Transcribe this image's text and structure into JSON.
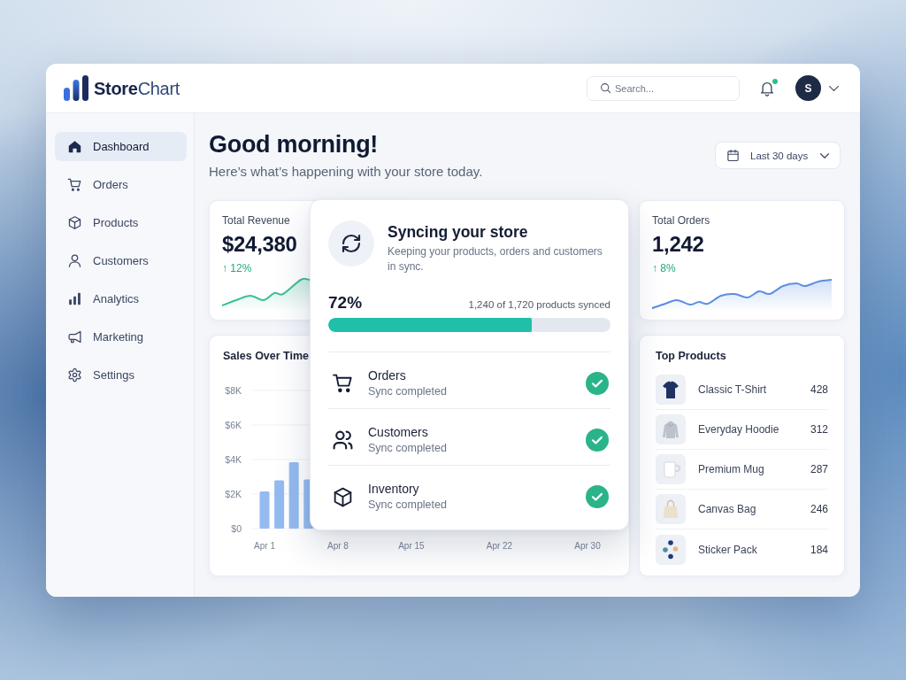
{
  "header": {
    "brand": "**Store**Chart",
    "search": {
      "placeholder": "Search..."
    },
    "notifications": {
      "unread": true
    },
    "user": {
      "initial": "S"
    }
  },
  "sidebar": {
    "items": [
      {
        "label": "Dashboard",
        "selected": true
      },
      {
        "label": "Orders",
        "selected": false
      },
      {
        "label": "Products",
        "selected": false
      },
      {
        "label": "Customers",
        "selected": false
      },
      {
        "label": "Analytics",
        "selected": false
      },
      {
        "label": "Marketing",
        "selected": false
      },
      {
        "label": "Settings",
        "selected": false
      }
    ]
  },
  "greeting": {
    "title": "Good morning!",
    "subtitle": "Here’s what’s happening with your store today."
  },
  "date_range": {
    "value": "Last 30 days"
  },
  "stats": [
    {
      "label": "Total Revenue",
      "value": "$24,380",
      "change": "↑ 12%"
    },
    {
      "label": "Total Orders",
      "value": "1,242",
      "change": "↑ 8%"
    }
  ],
  "sales_chart": {
    "chart_data": {
      "type": "bar",
      "title": "Sales Over Time",
      "categories": [
        "Apr 1",
        null,
        null,
        null,
        null,
        "Apr 8",
        null,
        null,
        null,
        null,
        "Apr 15",
        null,
        null,
        null,
        null,
        null,
        "Apr 22",
        null,
        null,
        null,
        null,
        null,
        "Apr 30"
      ],
      "series": [
        {
          "color": "#94bbef",
          "values": [
            2150,
            2800,
            3850,
            2850,
            null,
            null,
            null,
            null,
            null,
            null,
            null,
            null,
            null,
            null,
            null,
            null,
            null,
            null,
            null,
            null,
            null,
            null,
            null
          ]
        }
      ],
      "ylim": [
        0,
        8000
      ],
      "yticks": [
        {
          "value": 0,
          "label": "$0"
        },
        {
          "value": 2000,
          "label": "$2K"
        },
        {
          "value": 4000,
          "label": "$4K"
        },
        {
          "value": 6000,
          "label": "$6K"
        },
        {
          "value": 8000,
          "label": "$8K"
        }
      ],
      "grid": true
    }
  },
  "top_products": {
    "title": "Top Products",
    "items": [
      {
        "name": "Classic T-Shirt",
        "count": "428"
      },
      {
        "name": "Everyday Hoodie",
        "count": "312"
      },
      {
        "name": "Premium Mug",
        "count": "287"
      },
      {
        "name": "Canvas Bag",
        "count": "246"
      },
      {
        "name": "Sticker Pack",
        "count": "184"
      }
    ]
  },
  "sync_dialog": {
    "title": "Syncing your store",
    "description": "Keeping your products, orders and customers in sync.",
    "percent": "72%",
    "detail": "1,240 of 1,720 products synced",
    "level": 0.72,
    "items": [
      {
        "name": "Orders",
        "status": "Sync completed",
        "done": true
      },
      {
        "name": "Customers",
        "status": "Sync completed",
        "done": true
      },
      {
        "name": "Inventory",
        "status": "Sync completed",
        "done": true
      }
    ]
  }
}
